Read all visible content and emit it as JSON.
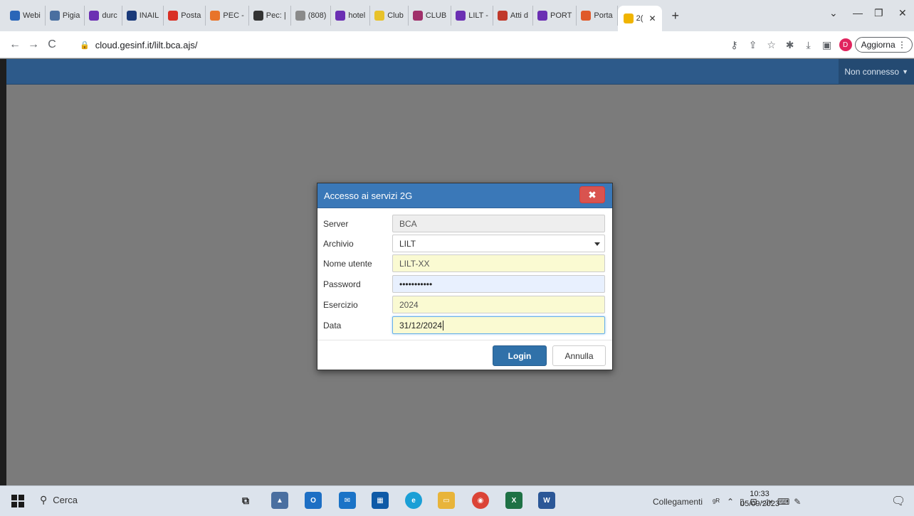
{
  "browser": {
    "tabs": [
      {
        "label": "Webi",
        "icon": "globe-icon",
        "color": "#2a66b8"
      },
      {
        "label": "Pigia",
        "icon": "runner-icon",
        "color": "#4a6fa0"
      },
      {
        "label": "durc",
        "icon": "y-icon",
        "color": "#6b2fb3"
      },
      {
        "label": "INAIL",
        "icon": "inail-icon",
        "color": "#1a3a7a"
      },
      {
        "label": "Posta",
        "icon": "gmail-icon",
        "color": "#d93025"
      },
      {
        "label": "PEC -",
        "icon": "pec-icon",
        "color": "#e8742a"
      },
      {
        "label": "Pec: |",
        "icon": "pec2-icon",
        "color": "#333333"
      },
      {
        "label": "(808)",
        "icon": "mail-icon",
        "color": "#8a8a8a"
      },
      {
        "label": "hotel",
        "icon": "y-icon",
        "color": "#6b2fb3"
      },
      {
        "label": "Club",
        "icon": "club-icon",
        "color": "#e8c22a"
      },
      {
        "label": "CLUB",
        "icon": "club2-icon",
        "color": "#a0306a"
      },
      {
        "label": "LILT -",
        "icon": "y-icon",
        "color": "#6b2fb3"
      },
      {
        "label": "Atti d",
        "icon": "atti-icon",
        "color": "#c0392b"
      },
      {
        "label": "PORT",
        "icon": "y-icon",
        "color": "#6b2fb3"
      },
      {
        "label": "Porta",
        "icon": "porta-icon",
        "color": "#e05a2a"
      },
      {
        "label": "2(",
        "icon": "2g-icon",
        "color": "#f0b400",
        "active": true
      }
    ],
    "url": "cloud.gesinf.it/lilt.bca.ajs/",
    "profile_initial": "D",
    "update_label": "Aggiorna"
  },
  "app": {
    "status": "Non connesso",
    "dialog": {
      "title": "Accesso ai servizi 2G",
      "close_label": "✖",
      "fields": {
        "server_label": "Server",
        "server_value": "BCA",
        "archivio_label": "Archivio",
        "archivio_value": "LILT",
        "user_label": "Nome utente",
        "user_value": "LILT-XX",
        "password_label": "Password",
        "password_value": "•••••••••••",
        "esercizio_label": "Esercizio",
        "esercizio_value": "2024",
        "data_label": "Data",
        "data_value": "31/12/2024"
      },
      "login_label": "Login",
      "cancel_label": "Annulla"
    }
  },
  "taskbar": {
    "search_label": "Cerca",
    "links_label": "Collegamenti",
    "time": "10:33",
    "date": "05/09/2023"
  }
}
